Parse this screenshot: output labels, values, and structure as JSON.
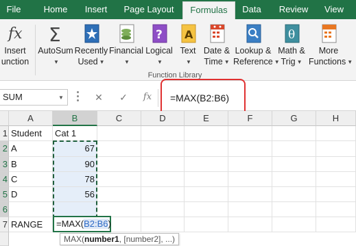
{
  "tabs": [
    "File",
    "Home",
    "Insert",
    "Page Layout",
    "Formulas",
    "Data",
    "Review",
    "View"
  ],
  "active_tab": "Formulas",
  "ribbon": {
    "insert_function": [
      "Insert",
      "unction"
    ],
    "buttons": [
      {
        "icon": "autosum-icon",
        "line1": "AutoSum",
        "line2": ""
      },
      {
        "icon": "recently-used-icon",
        "line1": "Recently",
        "line2": "Used"
      },
      {
        "icon": "financial-icon",
        "line1": "Financial",
        "line2": ""
      },
      {
        "icon": "logical-icon",
        "line1": "Logical",
        "line2": ""
      },
      {
        "icon": "text-icon",
        "line1": "Text",
        "line2": ""
      },
      {
        "icon": "date-time-icon",
        "line1": "Date &",
        "line2": "Time"
      },
      {
        "icon": "lookup-reference-icon",
        "line1": "Lookup &",
        "line2": "Reference"
      },
      {
        "icon": "math-trig-icon",
        "line1": "Math &",
        "line2": "Trig"
      },
      {
        "icon": "more-functions-icon",
        "line1": "More",
        "line2": "Functions"
      }
    ],
    "group_label": "Function Library"
  },
  "formula_bar": {
    "name_box": "SUM",
    "formula": "=MAX(B2:B6)"
  },
  "columns": [
    "A",
    "B",
    "C",
    "D",
    "E",
    "F",
    "G",
    "H"
  ],
  "rows": [
    "1",
    "2",
    "3",
    "4",
    "5",
    "6",
    "7"
  ],
  "cells": {
    "a1": "Student",
    "b1": "Cat 1",
    "a2": "A",
    "b2": "67",
    "a3": "B",
    "b3": "90",
    "a4": "C",
    "b4": "78",
    "a5": "D",
    "b5": "56",
    "a7": "RANGE"
  },
  "editing": {
    "prefix": "=MAX(",
    "ref": "B2:B6",
    "suffix": ")"
  },
  "tooltip": {
    "fn": "MAX(",
    "arg1": "number1",
    "rest": ", [number2], ...)"
  },
  "colors": {
    "accent": "#217346",
    "callout": "#e03030",
    "reference": "#2f6bc5"
  }
}
